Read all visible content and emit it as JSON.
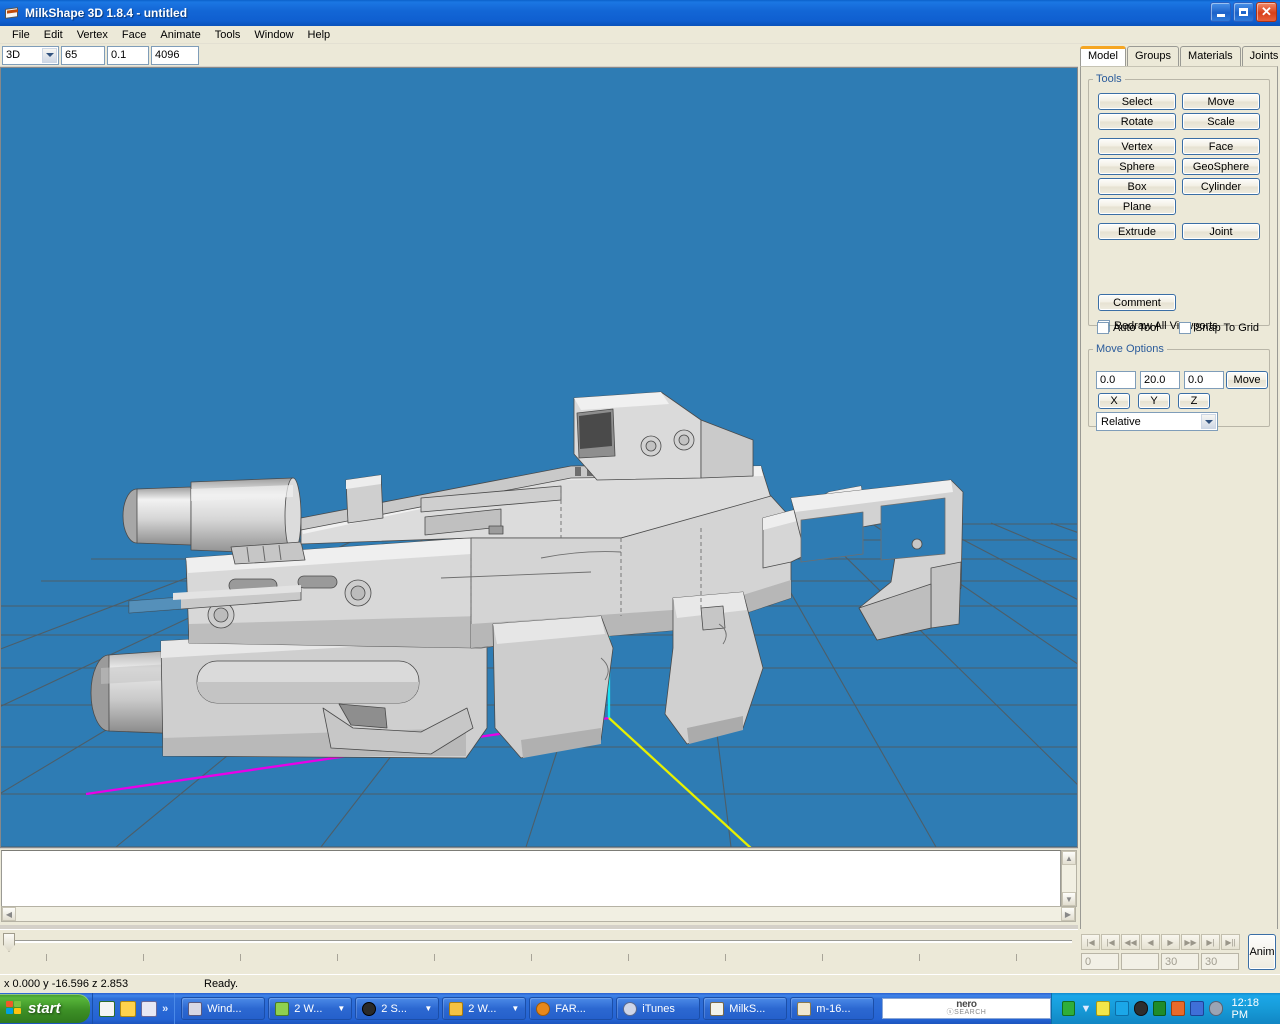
{
  "window": {
    "title": "MilkShape 3D 1.8.4 - untitled",
    "icon": "milkshape-icon",
    "controls": {
      "minimize": "_",
      "restore": "□",
      "close": "✕"
    }
  },
  "menu": {
    "items": [
      "File",
      "Edit",
      "Vertex",
      "Face",
      "Animate",
      "Tools",
      "Window",
      "Help"
    ]
  },
  "toolbar": {
    "view_mode": "3D",
    "field1": "65",
    "field2": "0.1",
    "field3": "4096"
  },
  "viewport": {
    "background_color": "#2e7cb4",
    "grid_color": "#5a5f62",
    "axis_x_color": "#e800e8",
    "axis_y_color": "#00e8f0",
    "axis_z_color": "#e8f000",
    "model_name": "assault-rifle-model",
    "model_color": "#d9d9d9"
  },
  "panel": {
    "tabs": [
      {
        "label": "Model",
        "active": true
      },
      {
        "label": "Groups",
        "active": false
      },
      {
        "label": "Materials",
        "active": false
      },
      {
        "label": "Joints",
        "active": false
      }
    ],
    "tools": {
      "legend": "Tools",
      "buttons": [
        "Select",
        "Move",
        "Rotate",
        "Scale",
        "Vertex",
        "Face",
        "Sphere",
        "GeoSphere",
        "Box",
        "Cylinder",
        "Plane",
        "Extrude",
        "Joint"
      ],
      "comment_label": "Comment",
      "checkboxes": [
        {
          "label": "Redraw All Viewports",
          "checked": true
        },
        {
          "label": "Auto Tool",
          "checked": false
        },
        {
          "label": "Snap To Grid",
          "checked": false
        }
      ]
    },
    "move_options": {
      "legend": "Move Options",
      "x_value": "0.0",
      "y_value": "20.0",
      "z_value": "0.0",
      "move_label": "Move",
      "axis_buttons": [
        "X",
        "Y",
        "Z"
      ],
      "mode": "Relative"
    }
  },
  "animation": {
    "transport": [
      "|◀",
      "|◀",
      "◀◀",
      "◀",
      "▶",
      "▶▶",
      "▶|",
      "▶||"
    ],
    "fields": [
      "0",
      "",
      "30",
      "30"
    ],
    "anim_label": "Anim"
  },
  "status": {
    "coords": "x 0.000 y -16.596 z 2.853",
    "message": "Ready."
  },
  "taskbar": {
    "start_label": "start",
    "quicklaunch": [
      "media-player-icon",
      "running-man-icon",
      "window-icon"
    ],
    "quicklaunch_chevron": "»",
    "tasks": [
      {
        "label": "Wind...",
        "icon": "computer-icon",
        "has_arrow": false
      },
      {
        "label": "2 W...",
        "icon": "people-icon",
        "has_arrow": true
      },
      {
        "label": "2 S...",
        "icon": "steam-icon",
        "has_arrow": true
      },
      {
        "label": "2 W...",
        "icon": "folder-icon",
        "has_arrow": true
      },
      {
        "label": "FAR...",
        "icon": "globe-icon",
        "has_arrow": false
      },
      {
        "label": "iTunes",
        "icon": "itunes-icon",
        "has_arrow": false
      },
      {
        "label": "MilkS...",
        "icon": "milkshape-icon",
        "has_arrow": false
      },
      {
        "label": "m-16...",
        "icon": "paint-icon",
        "has_arrow": false
      }
    ],
    "search_bar": {
      "brand": "nero",
      "sub": "ⓢSEARCH"
    },
    "tray_icons": [
      "arrow-green-icon",
      "help-icon",
      "network-icon",
      "shield-icon",
      "sound-icon",
      "grid-icon",
      "users-icon",
      "update-icon",
      "app-icon"
    ],
    "clock": "12:18 PM"
  }
}
